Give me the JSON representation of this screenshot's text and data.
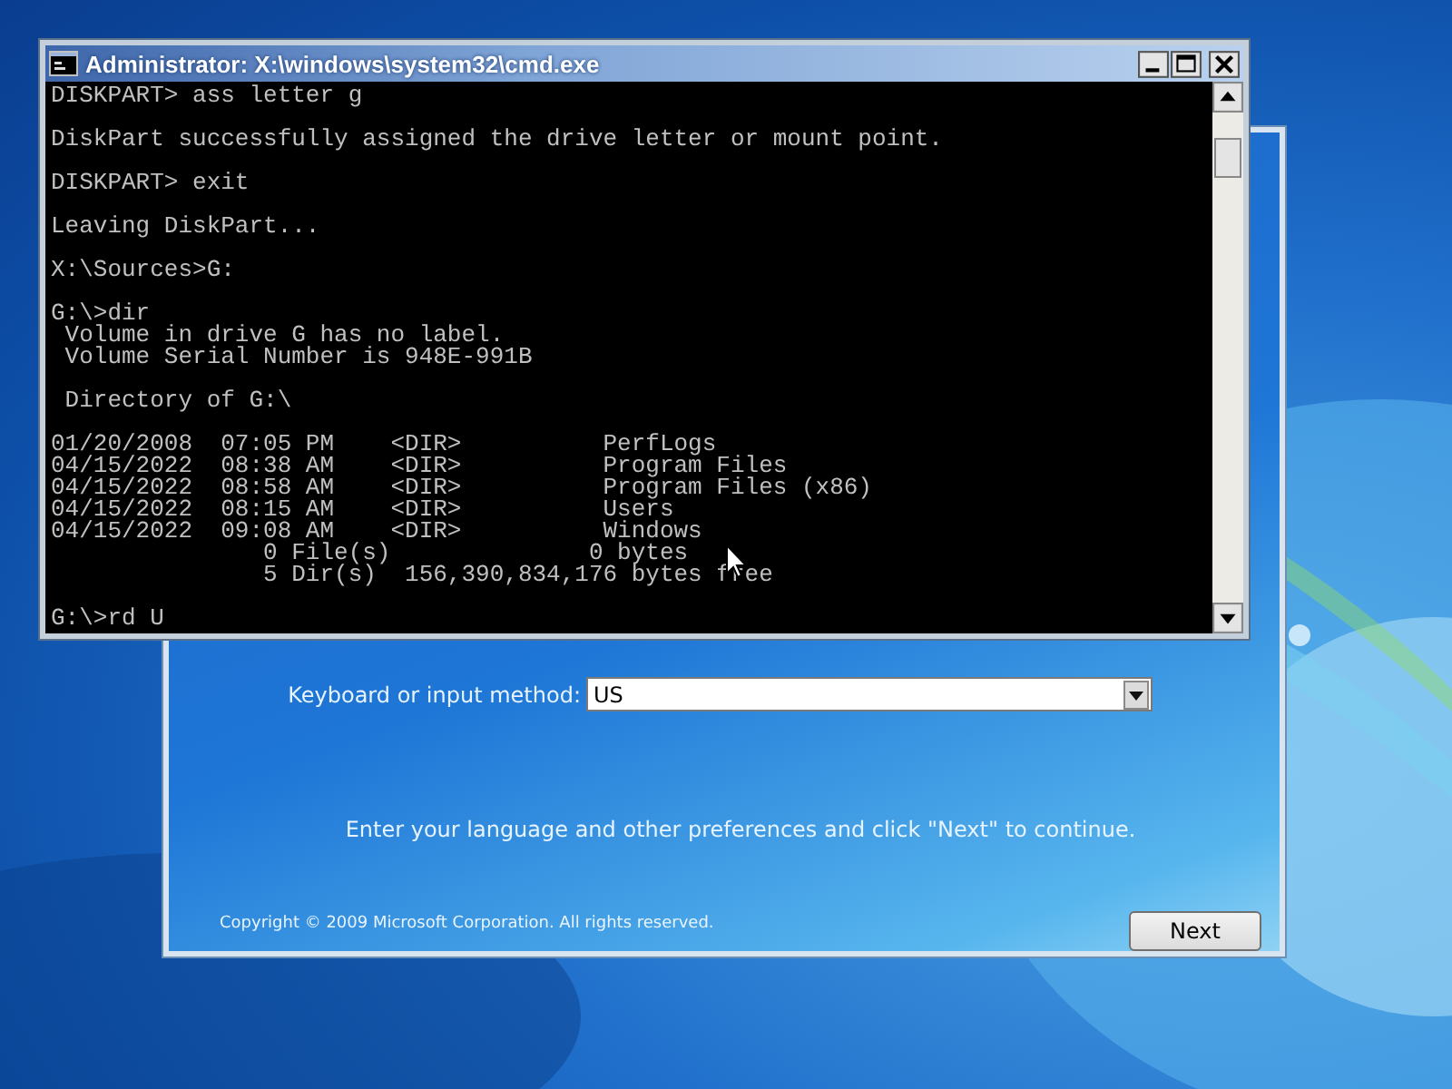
{
  "cmd_window": {
    "title": "Administrator: X:\\windows\\system32\\cmd.exe",
    "paragraphs": [
      [
        "DISKPART> ass letter g"
      ],
      [
        "DiskPart successfully assigned the drive letter or mount point."
      ],
      [
        "DISKPART> exit"
      ],
      [
        "Leaving DiskPart..."
      ],
      [
        "X:\\Sources>G:"
      ],
      [
        "G:\\>dir",
        " Volume in drive G has no label.",
        " Volume Serial Number is 948E-991B"
      ],
      [
        " Directory of G:\\"
      ],
      [
        "01/20/2008  07:05 PM    <DIR>          PerfLogs",
        "04/15/2022  08:38 AM    <DIR>          Program Files",
        "04/15/2022  08:58 AM    <DIR>          Program Files (x86)",
        "04/15/2022  08:15 AM    <DIR>          Users",
        "04/15/2022  09:08 AM    <DIR>          Windows",
        "               0 File(s)              0 bytes",
        "               5 Dir(s)  156,390,834,176 bytes free"
      ],
      [
        "G:\\>rd U"
      ]
    ]
  },
  "setup_window": {
    "keyboard_label": "Keyboard or input method:",
    "keyboard_value": "US",
    "instruction": "Enter your language and other preferences and click \"Next\" to continue.",
    "copyright": "Copyright © 2009 Microsoft Corporation. All rights reserved.",
    "next_button": "Next"
  }
}
